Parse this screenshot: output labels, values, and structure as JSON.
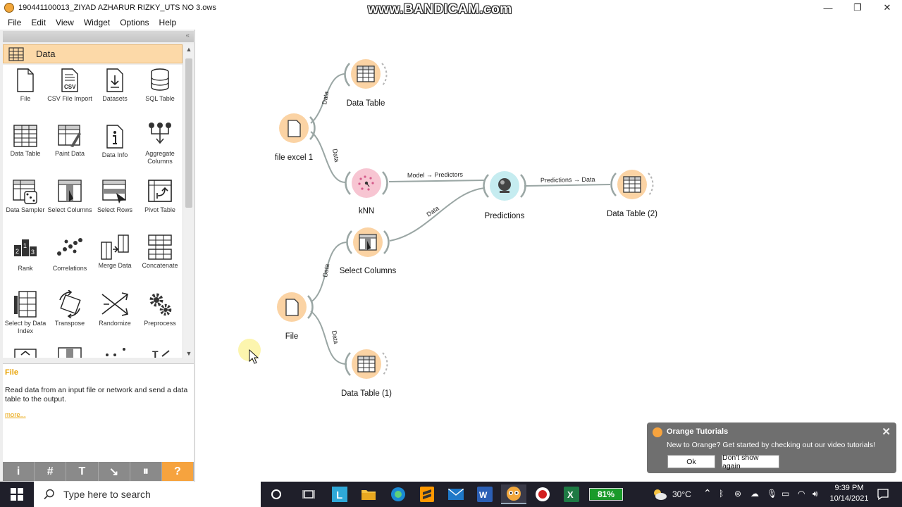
{
  "window": {
    "title": "190441100013_ZIYAD AZHARUR RIZKY_UTS NO 3.ows",
    "watermark": "www.BANDICAM.com",
    "controls": [
      "—",
      "❐",
      "✕"
    ]
  },
  "menu": [
    "File",
    "Edit",
    "View",
    "Widget",
    "Options",
    "Help"
  ],
  "toolbox": {
    "category": "Data",
    "widgets": [
      "File",
      "CSV File Import",
      "Datasets",
      "SQL Table",
      "Data Table",
      "Paint Data",
      "Data Info",
      "Aggregate Columns",
      "Data Sampler",
      "Select Columns",
      "Select Rows",
      "Pivot Table",
      "Rank",
      "Correlations",
      "Merge Data",
      "Concatenate",
      "Select by Data Index",
      "Transpose",
      "Randomize",
      "Preprocess"
    ]
  },
  "description": {
    "title": "File",
    "text": "Read data from an input file or network and send a data table to the output.",
    "more": "more..."
  },
  "bottom_toolbar": [
    "i",
    "#",
    "T",
    "↘",
    "⏸",
    "?"
  ],
  "workflow": {
    "nodes": [
      "Data Table",
      "file excel 1",
      "kNN",
      "Predictions",
      "Data Table (2)",
      "Select Columns",
      "File",
      "Data Table (1)"
    ],
    "links": [
      "Data",
      "Data",
      "Model → Predictors",
      "Predictions → Data",
      "Data",
      "Data",
      "Data"
    ]
  },
  "notification": {
    "title": "Orange Tutorials",
    "message": "New to Orange? Get started by checking out our video tutorials!",
    "ok": "Ok",
    "dismiss": "Don't show again"
  },
  "taskbar": {
    "search_placeholder": "Type here to search",
    "battery": "81%",
    "weather": "30°C",
    "time": "9:39 PM",
    "date": "10/14/2021"
  },
  "colors": {
    "orange_node": "#fbd3a4",
    "knn_node": "#f7c5d2",
    "predictions_node": "#c5ecf0",
    "category_header": "#fcd9a8",
    "accent": "#e8a100"
  }
}
